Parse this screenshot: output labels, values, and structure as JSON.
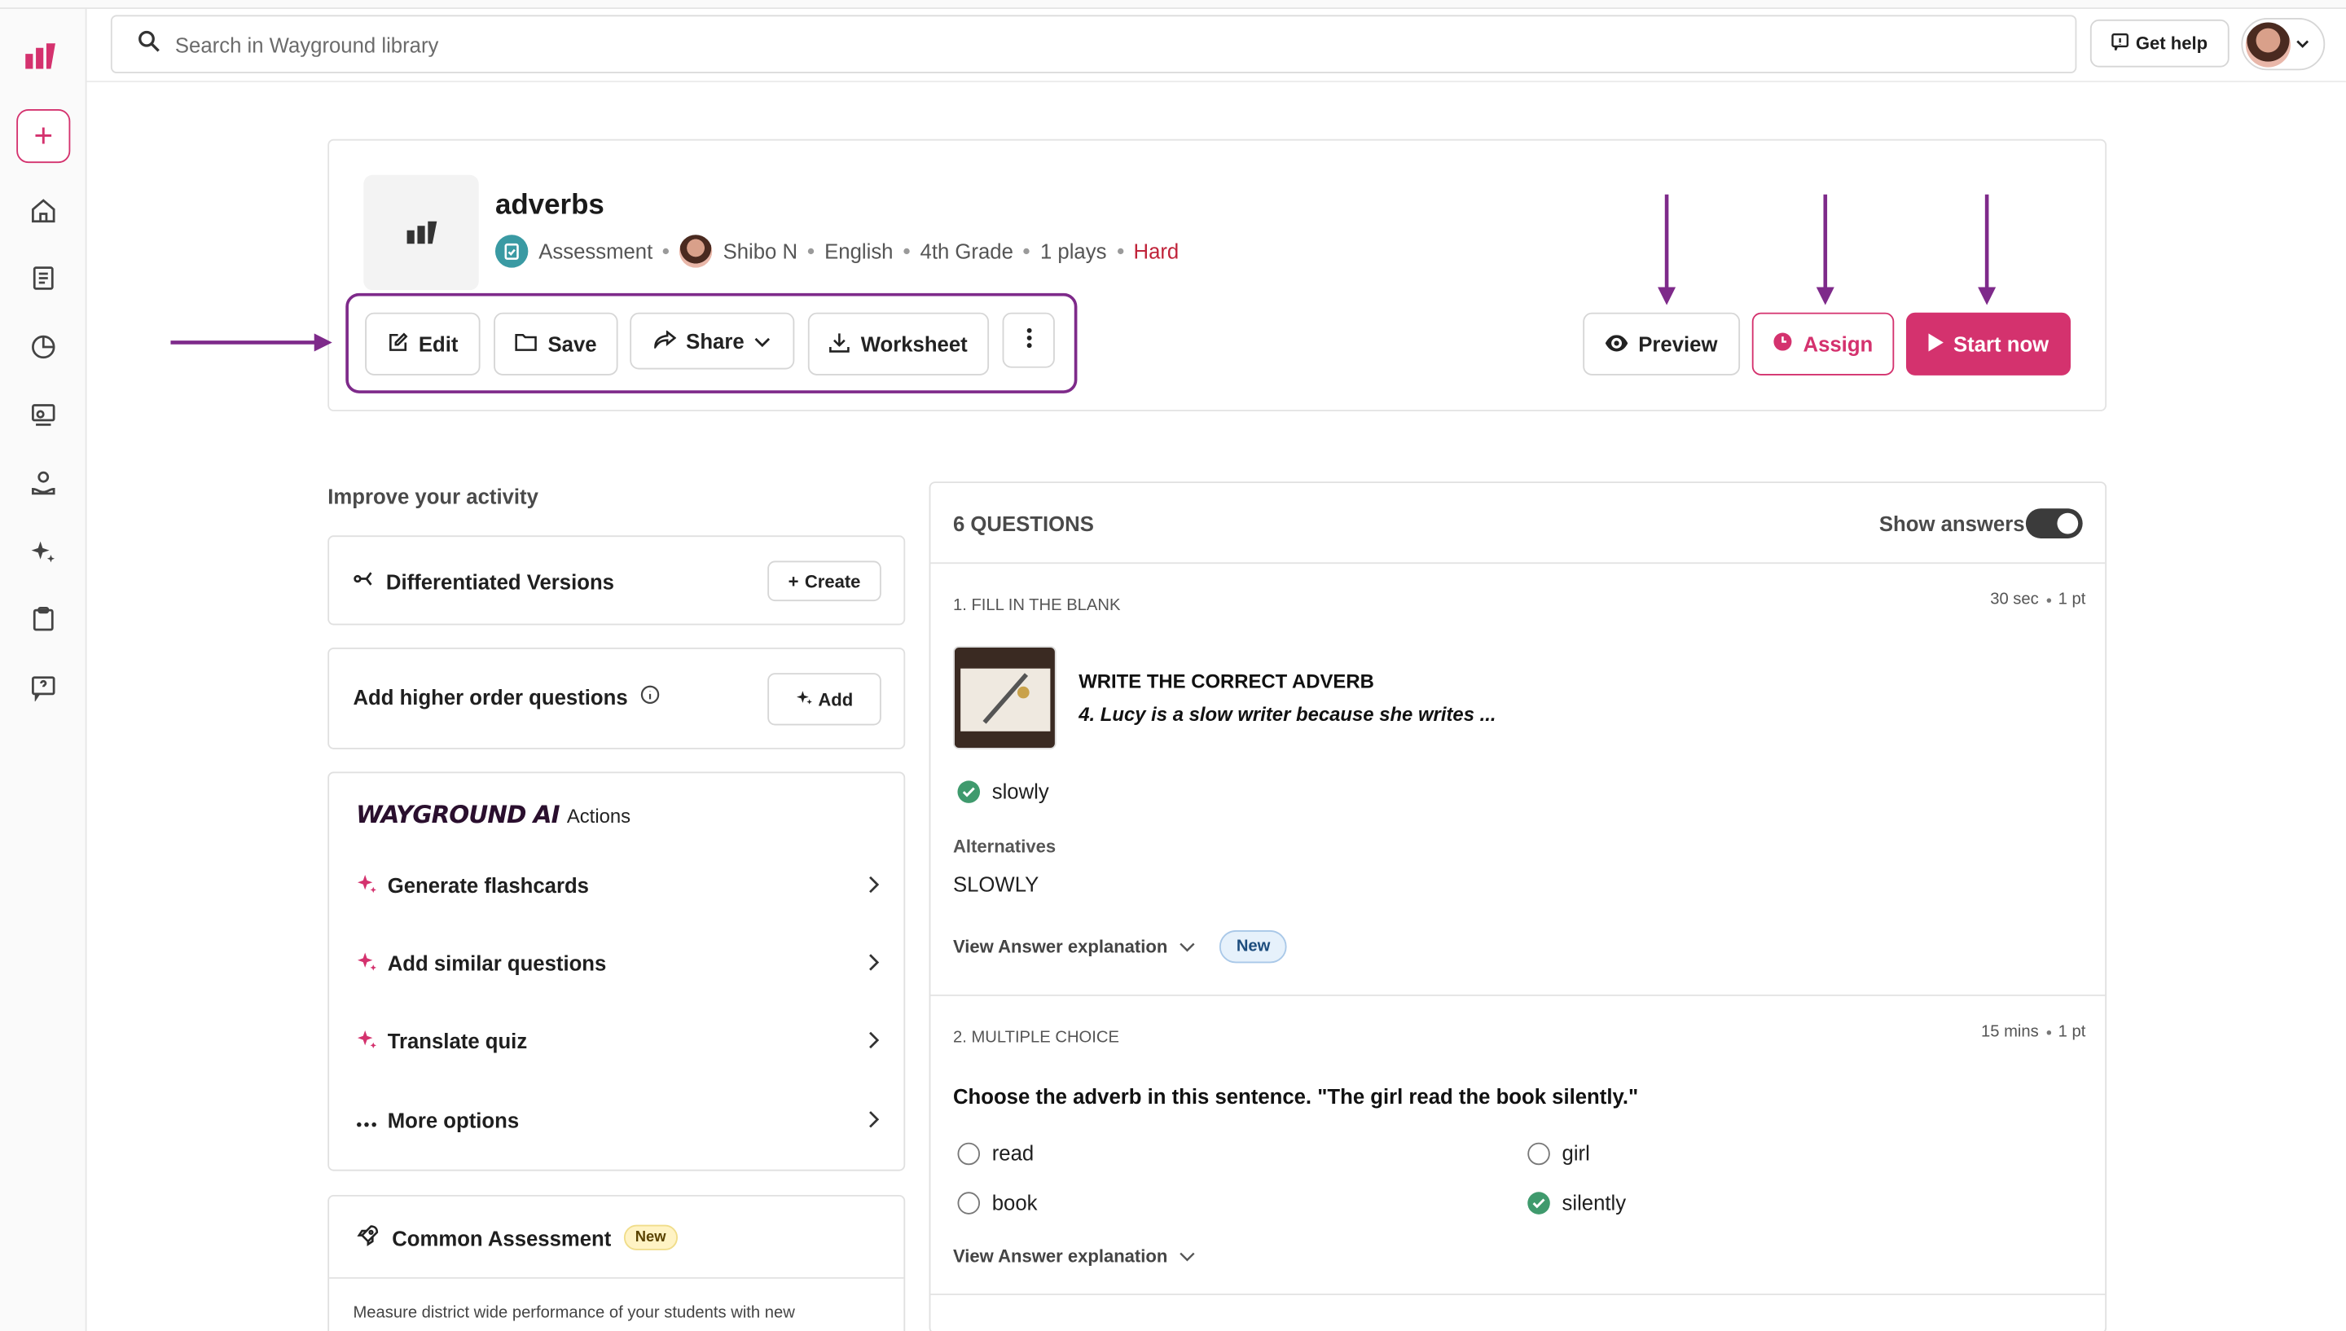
{
  "search": {
    "placeholder": "Search in Wayground library"
  },
  "header": {
    "help_label": "Get help"
  },
  "activity": {
    "title": "adverbs",
    "type": "Assessment",
    "author": "Shibo N",
    "subject": "English",
    "grade": "4th Grade",
    "plays": "1 plays",
    "difficulty": "Hard"
  },
  "actions": {
    "edit": "Edit",
    "save": "Save",
    "share": "Share",
    "worksheet": "Worksheet",
    "preview": "Preview",
    "assign": "Assign",
    "start": "Start now"
  },
  "improve": {
    "title": "Improve your activity",
    "differentiated": "Differentiated Versions",
    "create": "Create",
    "higher_order": "Add higher order questions",
    "add": "Add",
    "ai_brand": "WAYGROUND AI",
    "ai_actions": "Actions",
    "ai_items": [
      "Generate flashcards",
      "Add similar questions",
      "Translate quiz",
      "More options"
    ],
    "common_assessment": "Common Assessment",
    "common_badge": "New",
    "common_desc": "Measure district wide performance of your students with new"
  },
  "questions": {
    "count_label": "6 QUESTIONS",
    "show_answers": "Show answers",
    "show_answers_on": true,
    "items": [
      {
        "type": "1. FILL IN THE BLANK",
        "time": "30 sec",
        "points": "1 pt",
        "heading": "WRITE THE CORRECT ADVERB",
        "sentence": "4. Lucy is a slow writer because she writes ...",
        "answer": "slowly",
        "alternatives_label": "Alternatives",
        "alternative": "SLOWLY",
        "explanation": "View Answer explanation",
        "badge": "New"
      },
      {
        "type": "2. MULTIPLE CHOICE",
        "time": "15 mins",
        "points": "1 pt",
        "prompt": "Choose the adverb in this sentence. \"The girl read the book silently.\"",
        "options": [
          "read",
          "girl",
          "book",
          "silently"
        ],
        "correct": "silently",
        "explanation": "View Answer explanation"
      }
    ]
  },
  "colors": {
    "brand": "#d4326e",
    "highlight": "#7e2a8a",
    "correct": "#3f9a6d",
    "hard": "#c0233a"
  }
}
